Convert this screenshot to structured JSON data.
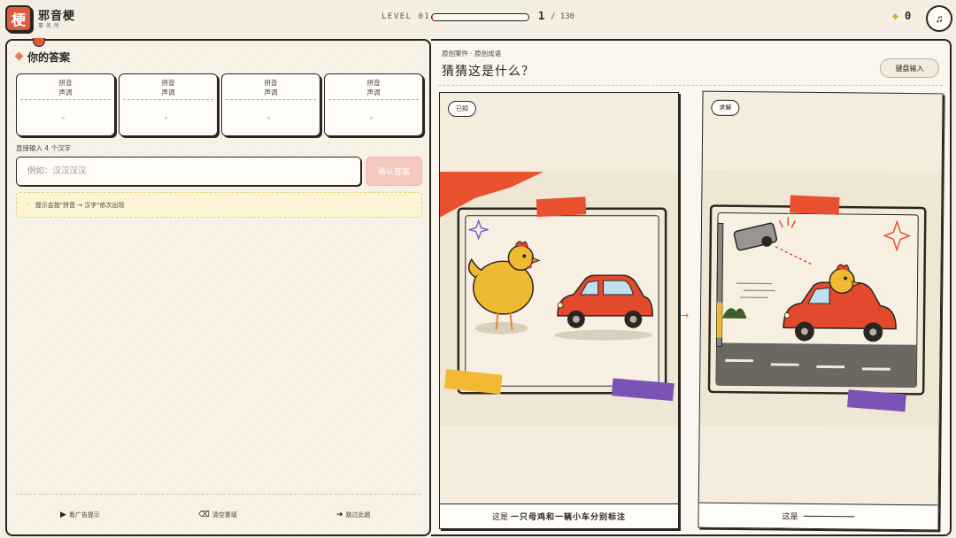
{
  "app": {
    "logo_char": "梗",
    "title": "邪音梗",
    "subtitle": "事务所"
  },
  "level": {
    "label": "LEVEL 01",
    "current": "1",
    "total": "/ 130",
    "progress_fraction": 0.0077
  },
  "coins": {
    "icon": "coin-diamond-icon",
    "count": "0"
  },
  "music": {
    "icon": "music-note-icon",
    "glyph": "♫"
  },
  "answer": {
    "title": "你的答案",
    "slots": [
      {
        "pinyin": "拼音",
        "tone": "声调",
        "char": "。"
      },
      {
        "pinyin": "拼音",
        "tone": "声调",
        "char": "。"
      },
      {
        "pinyin": "拼音",
        "tone": "声调",
        "char": "。"
      },
      {
        "pinyin": "拼音",
        "tone": "声调",
        "char": "。"
      }
    ],
    "direct_label": "直接输入 4 个汉字",
    "input_placeholder": "例如：汉汉汉汉",
    "input_value": "",
    "confirm_label": "确认答案",
    "hint_icon": "lightbulb-icon",
    "hint_text": "提示会按\"拼音 → 汉字\"依次出现"
  },
  "actions": {
    "watch_ad": "看广告提示",
    "clear": "清空重填",
    "skip": "跳过此题"
  },
  "case": {
    "tag": "原创案件 · 原创成语",
    "question": "猜猜这是什么？",
    "keyboard_label": "键盘输入",
    "known_tag": "已知",
    "solve_tag": "求解",
    "known_caption_prefix": "这是",
    "known_caption_bold": "一只母鸡和一辆小车分别标注",
    "solve_caption_prefix": "这是"
  },
  "colors": {
    "accent": "#e05a3a",
    "ink": "#2a2520",
    "paper": "#f5efe3",
    "hint_bg": "#fdf5d3"
  }
}
